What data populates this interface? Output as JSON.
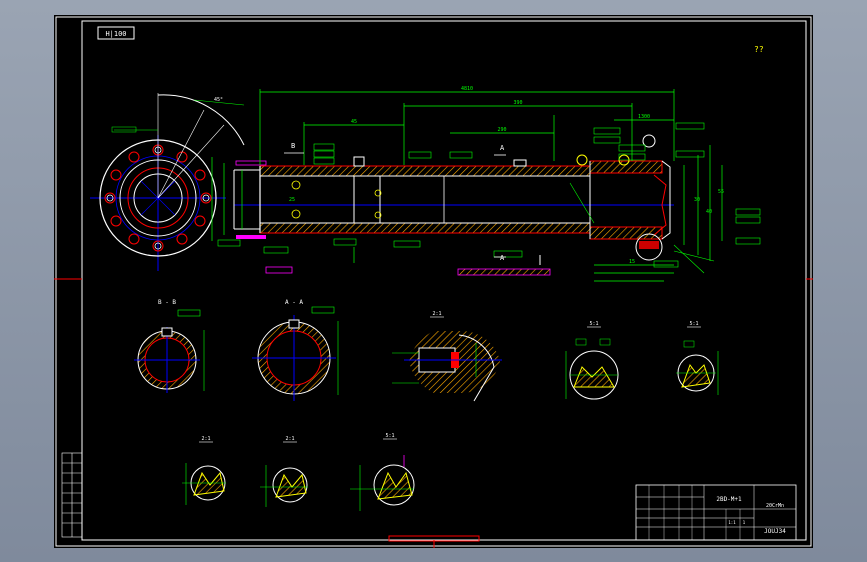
{
  "drawing": {
    "code_box": "H|100",
    "roughness_note": "??",
    "total_length": "4810",
    "segment_length": "390",
    "dims": [
      "45",
      "290",
      "1300",
      "25",
      "30",
      "40",
      "55",
      "15"
    ],
    "section_labels": {
      "bb": "B - B",
      "aa": "A - A",
      "d1": "2:1",
      "d2": "5:1",
      "d3": "5:1",
      "d4": "2:1",
      "d5": "2:1",
      "d6": "5:1"
    },
    "cut_marks": [
      "B",
      "A",
      "A"
    ],
    "title_block": {
      "part_code": "2BD-M+1",
      "scale": "1:1",
      "sheet": "1",
      "material": "20CrMn",
      "drawing_no": "JOUJ34"
    },
    "colors": {
      "outline": "#ffffff",
      "frame": "#ff0000",
      "dimension": "#00ff00",
      "centerline": "#0000ff",
      "hatch": "#ffaa00",
      "detail": "#ffff00",
      "hidden": "#ff00ff"
    }
  }
}
